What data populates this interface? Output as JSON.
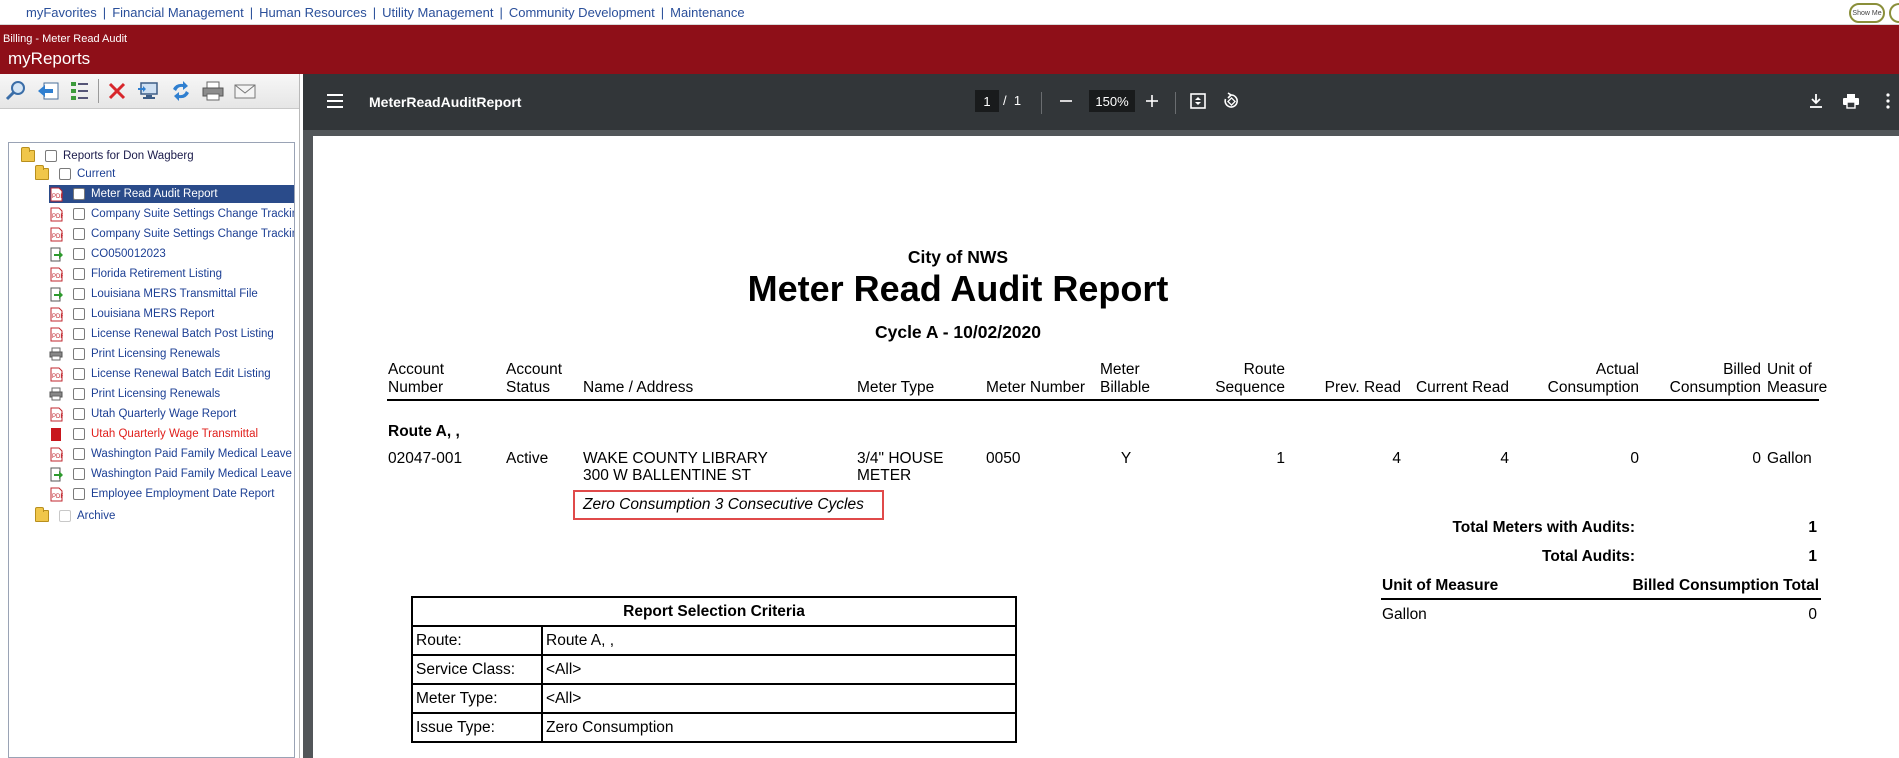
{
  "topnav": {
    "items": [
      "myFavorites",
      "Financial Management",
      "Human Resources",
      "Utility Management",
      "Community Development",
      "Maintenance"
    ],
    "show_me": "Show Me"
  },
  "header": {
    "breadcrumb": "Billing - Meter Read Audit",
    "title": "myReports"
  },
  "tree": {
    "root": "Reports for Don Wagberg",
    "current": "Current",
    "items": [
      {
        "label": "Meter Read Audit Report",
        "icon": "pdf-icon"
      },
      {
        "label": "Company Suite Settings Change Tracking",
        "icon": "pdf-icon"
      },
      {
        "label": "Company Suite Settings Change Tracking",
        "icon": "pdf-icon"
      },
      {
        "label": "CO050012023",
        "icon": "export-icon"
      },
      {
        "label": "Florida Retirement Listing",
        "icon": "pdf-icon"
      },
      {
        "label": "Louisiana MERS Transmittal File",
        "icon": "export-icon"
      },
      {
        "label": "Louisiana MERS Report",
        "icon": "pdf-icon"
      },
      {
        "label": "License Renewal Batch Post Listing",
        "icon": "pdf-icon"
      },
      {
        "label": "Print Licensing Renewals",
        "icon": "printer-icon"
      },
      {
        "label": "License Renewal Batch Edit Listing",
        "icon": "pdf-icon"
      },
      {
        "label": "Print Licensing Renewals",
        "icon": "printer-icon"
      },
      {
        "label": "Utah Quarterly Wage Report",
        "icon": "pdf-icon"
      },
      {
        "label": "Utah Quarterly Wage Transmittal",
        "icon": "error-icon"
      },
      {
        "label": "Washington Paid Family Medical Leave",
        "icon": "pdf-icon"
      },
      {
        "label": "Washington Paid Family Medical Leave",
        "icon": "export-icon"
      },
      {
        "label": "Employee Employment Date Report",
        "icon": "pdf-icon"
      }
    ],
    "archive": "Archive"
  },
  "viewer": {
    "filename": "MeterReadAuditReport",
    "page_current": "1",
    "page_sep": "/",
    "page_total": "1",
    "zoom": "150%"
  },
  "report": {
    "org": "City of NWS",
    "title": "Meter Read Audit Report",
    "cycle": "Cycle A - 10/02/2020",
    "columns": {
      "account_number": [
        "Account",
        "Number"
      ],
      "account_status": [
        "Account",
        "Status"
      ],
      "name_address": "Name / Address",
      "meter_type": "Meter Type",
      "meter_number": "Meter Number",
      "meter_billable": [
        "Meter",
        "Billable"
      ],
      "route_sequence": [
        "Route",
        "Sequence"
      ],
      "prev_read": "Prev. Read",
      "current_read": "Current Read",
      "actual_consumption": [
        "Actual",
        "Consumption"
      ],
      "billed_consumption": [
        "Billed",
        "Consumption"
      ],
      "unit_of_measure": [
        "Unit of",
        "Measure"
      ]
    },
    "route_heading": "Route A, ,",
    "row": {
      "account_number": "02047-001",
      "account_status": "Active",
      "name": "WAKE COUNTY LIBRARY",
      "address": "300 W BALLENTINE ST",
      "meter_type_1": "3/4\" HOUSE",
      "meter_type_2": "METER",
      "meter_number": "0050",
      "meter_billable": "Y",
      "route_sequence": "1",
      "prev_read": "4",
      "current_read": "4",
      "actual_consumption": "0",
      "billed_consumption": "0",
      "unit_of_measure": "Gallon"
    },
    "audit_flag": "Zero Consumption 3 Consecutive Cycles",
    "totals": {
      "meters_label": "Total Meters with Audits:",
      "meters_value": "1",
      "audits_label": "Total Audits:",
      "audits_value": "1",
      "uom_header": "Unit of Measure",
      "billed_total_header": "Billed Consumption Total",
      "uom_value": "Gallon",
      "billed_total_value": "0"
    },
    "criteria": {
      "title": "Report Selection Criteria",
      "rows": [
        {
          "label": "Route:",
          "value": "Route A, ,"
        },
        {
          "label": "Service Class:",
          "value": "<All>"
        },
        {
          "label": "Meter Type:",
          "value": "<All>"
        },
        {
          "label": "Issue Type:",
          "value": "Zero Consumption"
        }
      ]
    }
  }
}
